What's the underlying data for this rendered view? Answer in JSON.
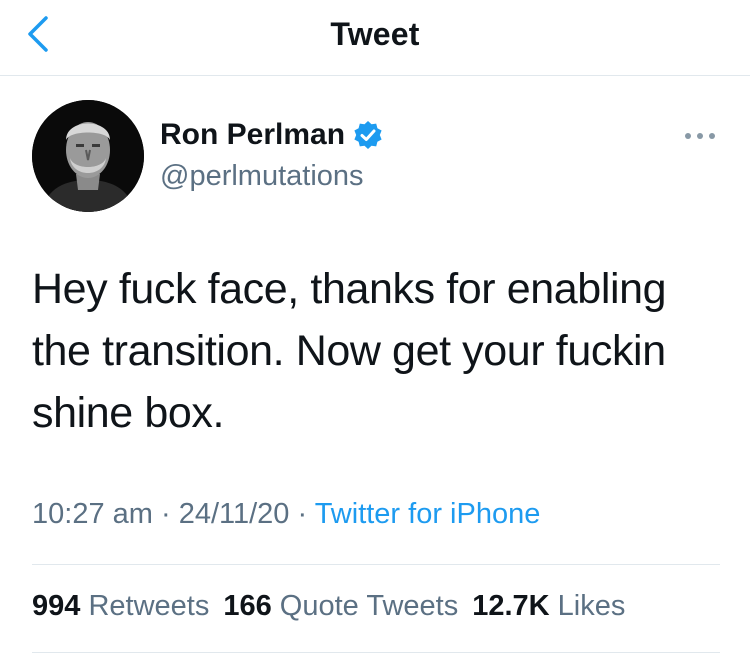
{
  "header": {
    "title": "Tweet",
    "back_icon": "chevron-left-icon",
    "accent": "#1d9bf0"
  },
  "author": {
    "name": "Ron Perlman",
    "handle": "@perlmutations",
    "verified": true,
    "verified_color": "#1d9bf0"
  },
  "tweet": {
    "lines": [
      "Hey fuck face, thanks for enabling",
      "the transition. Now get your fuckin",
      "shine box."
    ]
  },
  "meta": {
    "time": "10:27 am",
    "sep1": " · ",
    "date": "24/11/20",
    "sep2": " · ",
    "source": "Twitter for iPhone"
  },
  "stats": {
    "retweets_count": "994",
    "retweets_label": "Retweets",
    "quotes_count": "166",
    "quotes_label": "Quote Tweets",
    "likes_count": "12.7K",
    "likes_label": "Likes"
  }
}
